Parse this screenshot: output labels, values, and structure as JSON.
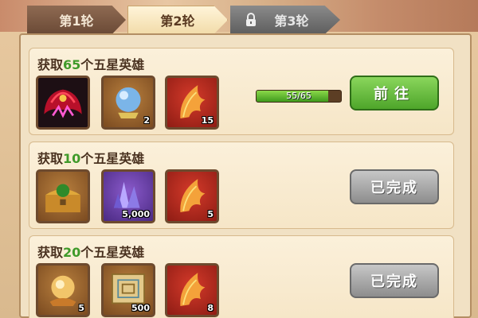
{
  "tabs": [
    {
      "label": "第1轮",
      "state": "inactive"
    },
    {
      "label": "第2轮",
      "state": "active"
    },
    {
      "label": "第3轮",
      "state": "locked"
    }
  ],
  "tasks": [
    {
      "title_prefix": "获取",
      "count": "65",
      "title_suffix": "个五星英雄",
      "rewards": [
        {
          "icon": "hero-skin-icon",
          "quantity": ""
        },
        {
          "icon": "crystal-ball-icon",
          "quantity": "2"
        },
        {
          "icon": "phoenix-feather-icon",
          "quantity": "15"
        }
      ],
      "progress": {
        "text": "55/65",
        "value": 55,
        "max": 65
      },
      "button": {
        "label": "前往",
        "state": "go"
      }
    },
    {
      "title_prefix": "获取",
      "count": "10",
      "title_suffix": "个五星英雄",
      "rewards": [
        {
          "icon": "treasure-chest-icon",
          "quantity": ""
        },
        {
          "icon": "purple-crystal-icon",
          "quantity": "5,000"
        },
        {
          "icon": "phoenix-feather-icon",
          "quantity": "5"
        }
      ],
      "button": {
        "label": "已完成",
        "state": "completed"
      }
    },
    {
      "title_prefix": "获取",
      "count": "20",
      "title_suffix": "个五星英雄",
      "rewards": [
        {
          "icon": "golden-orb-icon",
          "quantity": "5"
        },
        {
          "icon": "ancient-map-icon",
          "quantity": "500"
        },
        {
          "icon": "phoenix-feather-icon",
          "quantity": "8"
        }
      ],
      "button": {
        "label": "已完成",
        "state": "completed"
      }
    }
  ],
  "colors": {
    "count_text": "#3f9a2a",
    "go_button": "#4ea52a",
    "completed_button": "#8d8d8d",
    "progress_fill": "#5cc02a"
  }
}
